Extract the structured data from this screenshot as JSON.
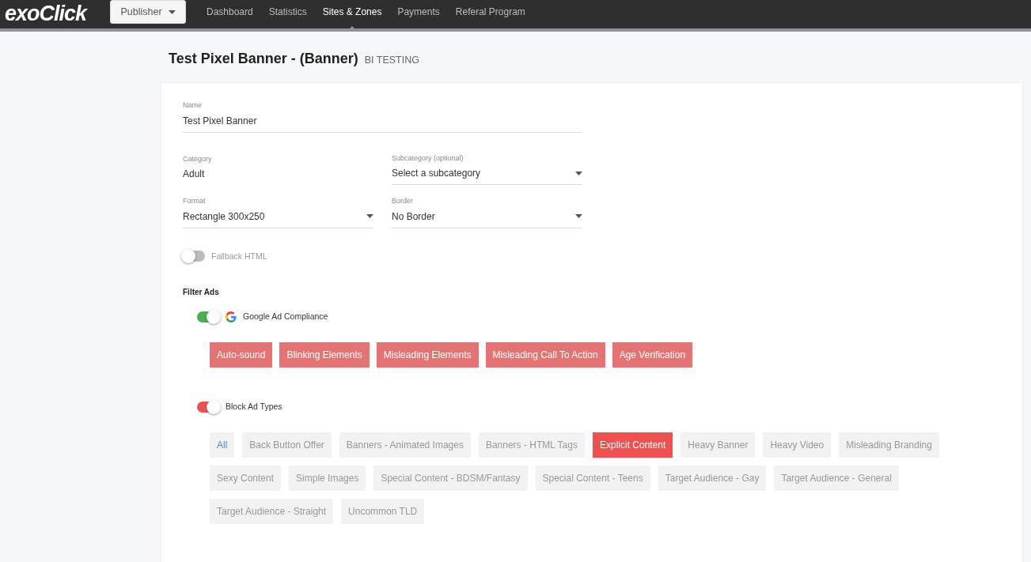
{
  "navbar": {
    "logo": "exoClick",
    "role_dropdown": "Publisher",
    "items": [
      {
        "label": "Dashboard",
        "selected": false
      },
      {
        "label": "Statistics",
        "selected": false
      },
      {
        "label": "Sites & Zones",
        "selected": true
      },
      {
        "label": "Payments",
        "selected": false
      },
      {
        "label": "Referal Program",
        "selected": false
      }
    ]
  },
  "page": {
    "title": "Test Pixel Banner - (Banner)",
    "subtitle": "BI TESTING"
  },
  "form": {
    "name": {
      "label": "Name",
      "value": "Test Pixel Banner"
    },
    "category": {
      "label": "Category",
      "value": "Adult"
    },
    "subcategory": {
      "label": "Subcategory (optional)",
      "value": "Select a subcategory"
    },
    "format": {
      "label": "Format",
      "value": "Rectangle 300x250"
    },
    "border": {
      "label": "Border",
      "value": "No Border"
    },
    "fallback": {
      "label": "Fallback HTML",
      "on": false
    }
  },
  "filter_ads": {
    "heading": "Filter Ads",
    "google": {
      "label": "Google Ad Compliance",
      "on": true,
      "chips": [
        "Auto-sound",
        "Blinking Elements",
        "Misleading Elements",
        "Misleading Call To Action",
        "Age Verification"
      ]
    },
    "block": {
      "label": "Block Ad Types",
      "on": true,
      "chips": [
        {
          "label": "All",
          "kind": "all",
          "selected": false
        },
        {
          "label": "Back Button Offer",
          "kind": "type",
          "selected": false
        },
        {
          "label": "Banners - Animated Images",
          "kind": "type",
          "selected": false
        },
        {
          "label": "Banners - HTML Tags",
          "kind": "type",
          "selected": false
        },
        {
          "label": "Explicit Content",
          "kind": "type",
          "selected": true
        },
        {
          "label": "Heavy Banner",
          "kind": "type",
          "selected": false
        },
        {
          "label": "Heavy Video",
          "kind": "type",
          "selected": false
        },
        {
          "label": "Misleading Branding",
          "kind": "type",
          "selected": false
        },
        {
          "label": "Sexy Content",
          "kind": "type",
          "selected": false
        },
        {
          "label": "Simple Images",
          "kind": "type",
          "selected": false
        },
        {
          "label": "Special Content - BDSM/Fantasy",
          "kind": "type",
          "selected": false
        },
        {
          "label": "Special Content - Teens",
          "kind": "type",
          "selected": false
        },
        {
          "label": "Target Audience - Gay",
          "kind": "type",
          "selected": false
        },
        {
          "label": "Target Audience - General",
          "kind": "type",
          "selected": false
        },
        {
          "label": "Target Audience - Straight",
          "kind": "type",
          "selected": false
        },
        {
          "label": "Uncommon TLD",
          "kind": "type",
          "selected": false
        }
      ]
    }
  }
}
